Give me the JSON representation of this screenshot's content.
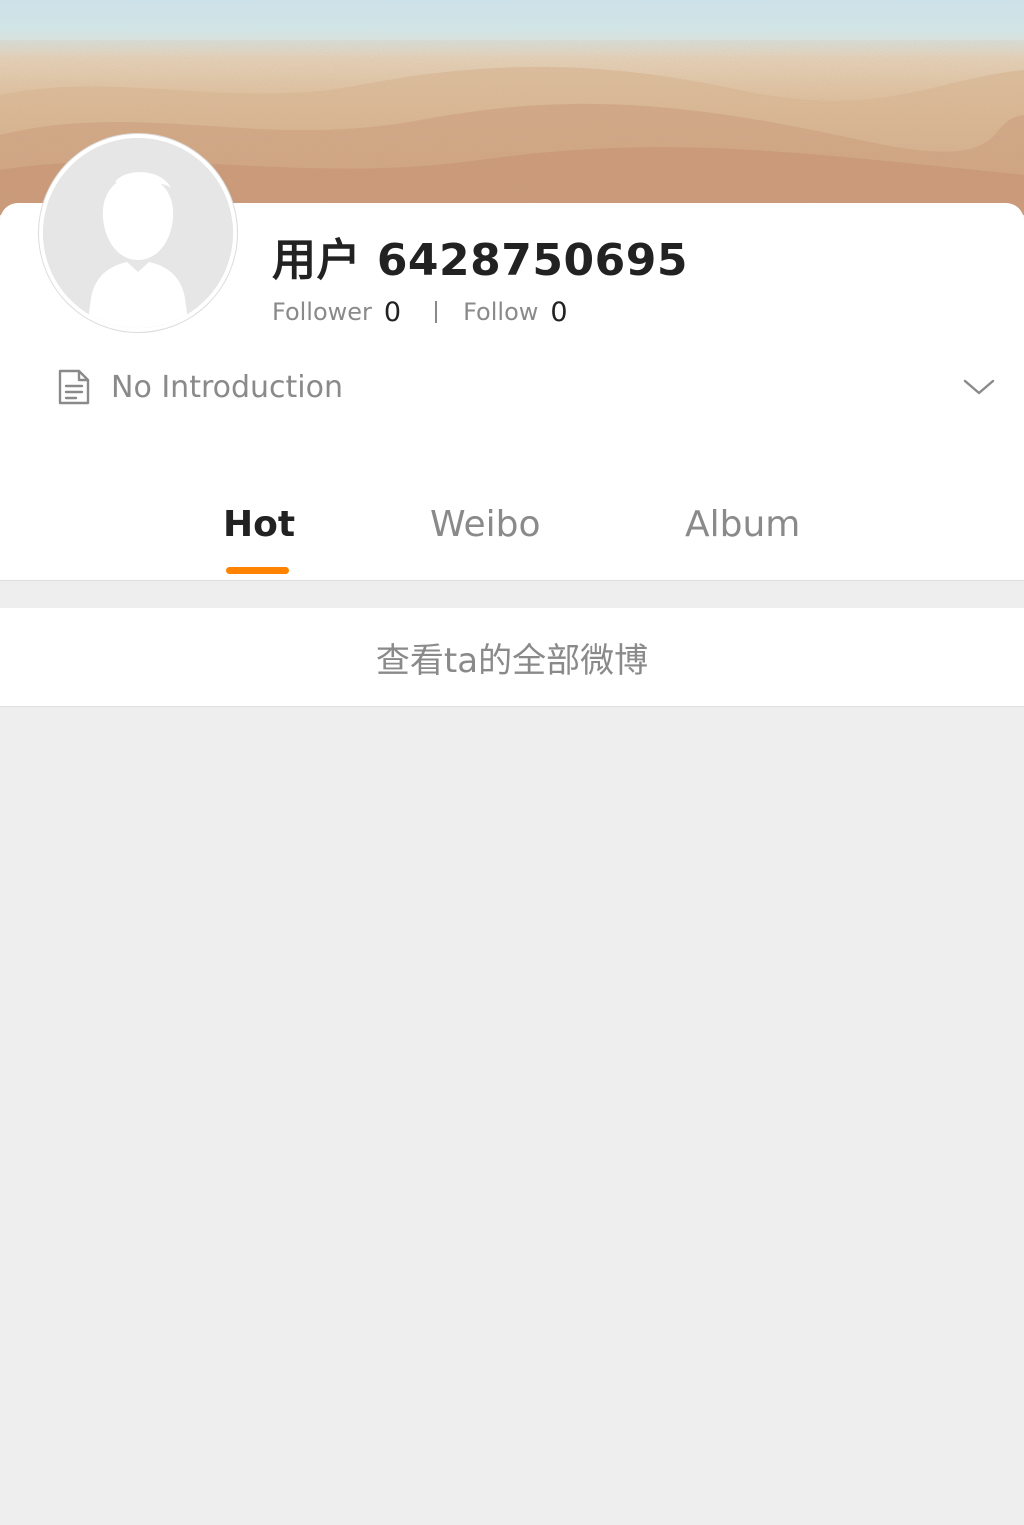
{
  "profile": {
    "username": "用户 6428750695",
    "follower_label": "Follower",
    "follower_count": "0",
    "follow_label": "Follow",
    "follow_count": "0",
    "introduction": "No Introduction"
  },
  "tabs": [
    {
      "label": "Hot",
      "active": true
    },
    {
      "label": "Weibo",
      "active": false
    },
    {
      "label": "Album",
      "active": false
    }
  ],
  "view_all_label": "查看ta的全部微博",
  "colors": {
    "accent": "#ff8200",
    "text_primary": "#222222",
    "text_secondary": "#8a8a8a",
    "page_background": "#eeeeee"
  },
  "icons": {
    "intro": "document-icon",
    "expand": "chevron-down-icon",
    "avatar": "default-avatar-silhouette"
  }
}
